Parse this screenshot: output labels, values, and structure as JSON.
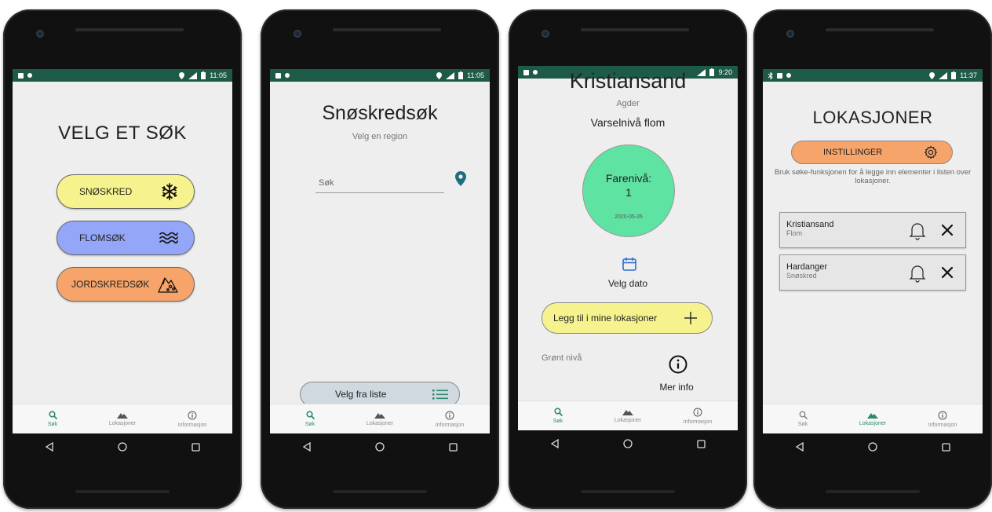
{
  "status": {
    "screen1_time": "11:05",
    "screen2_time": "11:05",
    "screen3_time": "9:20",
    "screen4_time": "11:37",
    "network": "LTE"
  },
  "bottom_nav": {
    "search_label": "Søk",
    "locations_label": "Lokasjoner",
    "info_label": "Informasjon"
  },
  "screen1": {
    "title": "VELG ET SØK",
    "buttons": [
      {
        "label": "SNØSKRED",
        "icon": "snowflake-icon",
        "color": "#f6f38e"
      },
      {
        "label": "FLOMSØK",
        "icon": "waves-icon",
        "color": "#93a6f8"
      },
      {
        "label": "JORDSKREDSØK",
        "icon": "landslide-icon",
        "color": "#f6a46a"
      }
    ]
  },
  "screen2": {
    "title": "Snøskredsøk",
    "subtitle": "Velg en region",
    "search_placeholder": "Søk",
    "list_button_label": "Velg fra liste"
  },
  "screen3": {
    "city": "Kristiansand",
    "region": "Agder",
    "warning_title": "Varselnivå flom",
    "danger_label": "Farenivå:",
    "danger_value": "1",
    "danger_date": "2020-05-26",
    "danger_color": "#5fe3a3",
    "choose_date_label": "Velg dato",
    "add_button_label": "Legg til i mine lokasjoner",
    "level_text": "Grønt nivå",
    "more_info_label": "Mer info"
  },
  "screen4": {
    "title": "LOKASJONER",
    "settings_label": "INSTILLINGER",
    "help_text": "Bruk søke-funksjonen for å legge inn elementer i listen over lokasjoner.",
    "locations": [
      {
        "name": "Kristiansand",
        "type": "Flom"
      },
      {
        "name": "Hardanger",
        "type": "Snøskred"
      }
    ]
  },
  "colors": {
    "statusbar": "#1e5a48",
    "accent": "#2e8a6e",
    "yellow": "#f6f38e",
    "blue": "#93a6f8",
    "orange": "#f6a46a"
  }
}
